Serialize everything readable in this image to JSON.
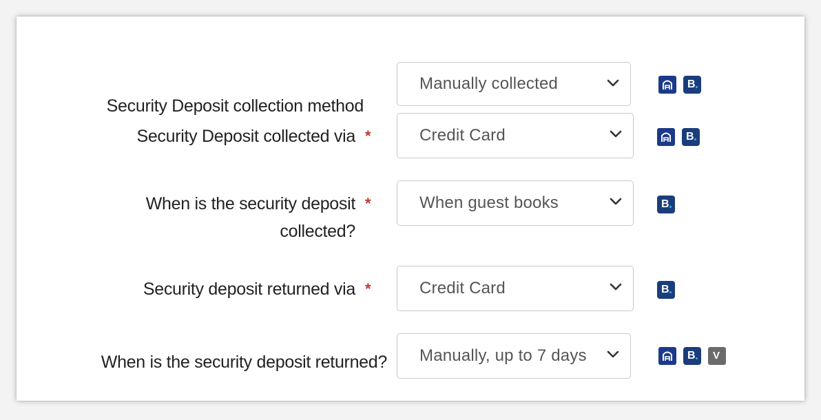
{
  "form": {
    "rows": [
      {
        "label": "Security Deposit collection method",
        "required": false,
        "value": "Manually collected",
        "icons": [
          "airbnb-icon",
          "booking-icon"
        ]
      },
      {
        "label": "Security Deposit collected via",
        "required": true,
        "value": "Credit Card",
        "icons": [
          "airbnb-icon",
          "booking-icon"
        ]
      },
      {
        "label": "When is the security deposit collected?",
        "required": true,
        "value": "When guest books",
        "icons": [
          "booking-icon"
        ]
      },
      {
        "label": "Security deposit returned via",
        "required": true,
        "value": "Credit Card",
        "icons": [
          "booking-icon"
        ]
      },
      {
        "label": "When is the security deposit returned?",
        "required": false,
        "value": "Manually, up to 7 days",
        "icons": [
          "airbnb-icon",
          "booking-icon",
          "vrbo-icon"
        ]
      }
    ],
    "required_marker": "*",
    "badges": {
      "booking_letter": "B",
      "vrbo_letter": "V"
    }
  },
  "colors": {
    "required": "#c0392b",
    "airbnb_badge": "#1c3a8a",
    "booking_badge": "#1a3d7c",
    "vrbo_badge": "#6b6b6b"
  }
}
